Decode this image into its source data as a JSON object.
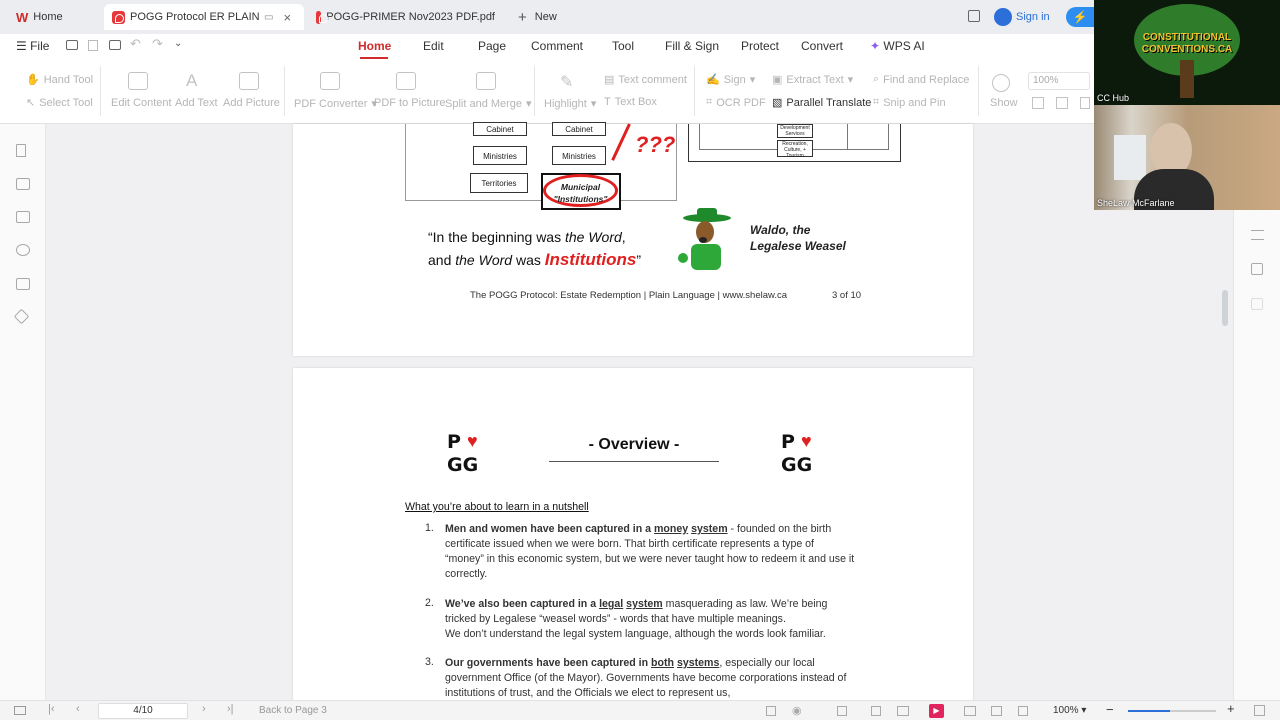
{
  "tabs": [
    {
      "label": "Home"
    },
    {
      "label": "POGG Protocol ER PLAIN LAN"
    },
    {
      "label": "POGG-PRIMER Nov2023 PDF.pdf"
    },
    {
      "label": "New"
    }
  ],
  "sign_in": "Sign in",
  "menu": {
    "file": "File",
    "items": [
      "Home",
      "Edit",
      "Page",
      "Comment",
      "Tool",
      "Fill & Sign",
      "Protect",
      "Convert",
      "WPS AI"
    ]
  },
  "ribbon": {
    "hand_tool": "Hand Tool",
    "select_tool": "Select Tool",
    "edit_content": "Edit Content",
    "add_text": "Add Text",
    "add_picture": "Add Picture",
    "pdf_converter": "PDF Converter",
    "pdf_to_picture": "PDF to Picture",
    "split_merge": "Split and Merge",
    "highlight": "Highlight",
    "text_comment": "Text comment",
    "text_box": "Text Box",
    "sign": "Sign",
    "ocr_pdf": "OCR PDF",
    "extract_text": "Extract Text",
    "parallel_translate": "Parallel Translate",
    "find_replace": "Find and Replace",
    "snip_pin": "Snip and Pin",
    "show": "Show",
    "zoom": "100%"
  },
  "video": {
    "participant1": "CC Hub",
    "participant2": "SheLaw McFarlane",
    "logo_text": "CONSTITUTIONAL CONVENTIONS.CA"
  },
  "page3": {
    "boxes": [
      "Cabinet",
      "Cabinet",
      "Ministries",
      "Ministries",
      "Territories",
      "Municipal \"Institutions\""
    ],
    "qmarks": "???",
    "dev_boxes": [
      "Development Services",
      "Recreation, Culture, + Tourism"
    ],
    "quote_line1_a": "“In the beginning was ",
    "quote_line1_b": "the Word",
    ",": ",",
    "quote_line2_a": "and ",
    "quote_line2_b": "the Word",
    " was": " was ",
    "quote_line2_c": "Institutions",
    "quote_end": "”",
    "waldo_line1": "Waldo, the",
    "waldo_line2": "Legalese Weasel",
    "footer": "The POGG Protocol: Estate Redemption | Plain Language | www.shelaw.ca",
    "page_of": "3 of 10"
  },
  "page4": {
    "logo_p": "P",
    "logo_g": "GG",
    "title": "- Overview -",
    "subheading": "What you’re about to learn in a nutshell",
    "items": [
      {
        "num": "1.",
        "bold_a": "Men and women have been captured in a ",
        "u1": "money",
        "sp": " ",
        "u2": "system",
        "rest": " - founded on the birth certificate issued when we were born. That birth certificate represents a type of “money” in this economic system, but we were never taught how to redeem it and use it correctly."
      },
      {
        "num": "2.",
        "bold_a": "We’ve also been captured in a ",
        "u1": "legal",
        "sp": " ",
        "u2": "system",
        "rest": " masquerading as law. We’re being tricked by Legalese “weasel words” - words that have multiple meanings.",
        "rest2": "We don’t understand the legal system language, although the words look familiar."
      },
      {
        "num": "3.",
        "bold_a": "Our governments have been captured in ",
        "u1": "both",
        "sp": " ",
        "u2": "systems",
        "rest": ", especially our local government Office (of the Mayor). Governments have become corporations instead of institutions of trust, and the Officials we elect to represent us,"
      }
    ]
  },
  "bottom": {
    "page_input": "4/10",
    "back": "Back to Page 3",
    "zoom": "100%"
  }
}
